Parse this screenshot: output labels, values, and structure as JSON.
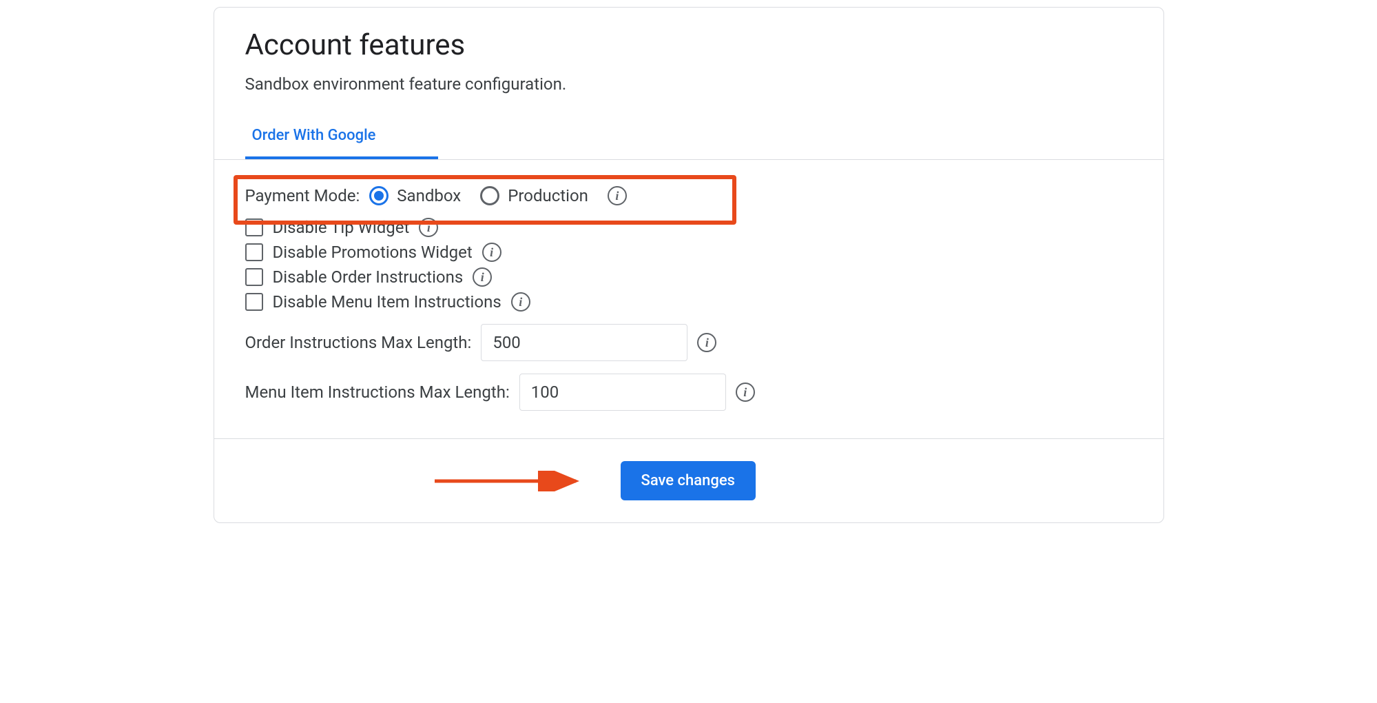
{
  "header": {
    "title": "Account features",
    "subtitle": "Sandbox environment feature configuration."
  },
  "tabs": {
    "active": "Order With Google"
  },
  "form": {
    "paymentMode": {
      "label": "Payment Mode:",
      "options": {
        "sandbox": "Sandbox",
        "production": "Production"
      },
      "selected": "sandbox"
    },
    "checkboxes": {
      "disableTip": "Disable Tip Widget",
      "disablePromotions": "Disable Promotions Widget",
      "disableOrderInstructions": "Disable Order Instructions",
      "disableMenuItemInstructions": "Disable Menu Item Instructions"
    },
    "inputs": {
      "orderInstructionsMax": {
        "label": "Order Instructions Max Length:",
        "value": "500"
      },
      "menuItemInstructionsMax": {
        "label": "Menu Item Instructions Max Length:",
        "value": "100"
      }
    }
  },
  "footer": {
    "saveButton": "Save changes"
  }
}
